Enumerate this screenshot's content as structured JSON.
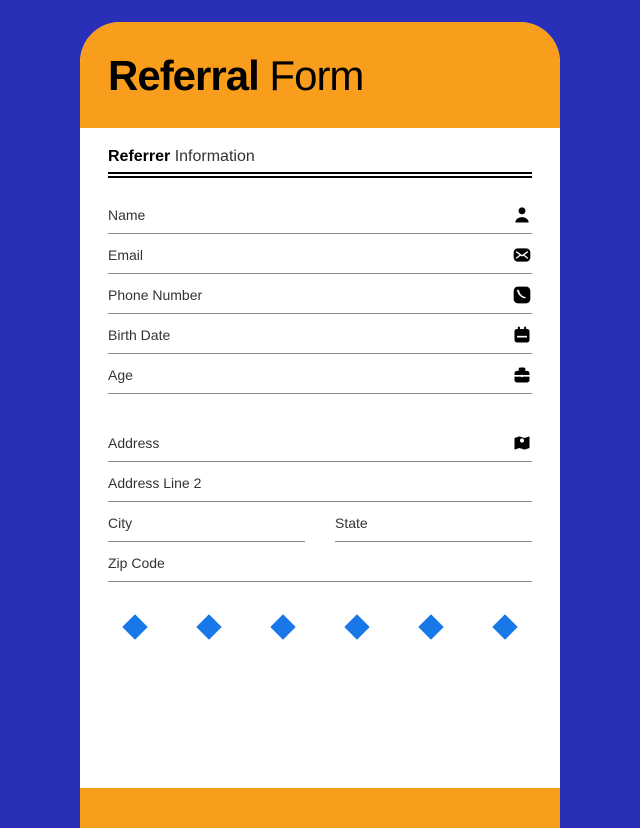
{
  "header": {
    "title_bold": "Referral",
    "title_rest": " Form"
  },
  "section": {
    "bold": "Referrer",
    "rest": " Information"
  },
  "fields": {
    "name": "Name",
    "email": "Email",
    "phone": "Phone Number",
    "birth": "Birth Date",
    "age": "Age",
    "address": "Address",
    "address2": "Address Line 2",
    "city": "City",
    "state": "State",
    "zip": "Zip Code"
  },
  "colors": {
    "bg": "#2a2fb8",
    "accent": "#f99d1c",
    "diamond": "#1878e8"
  }
}
